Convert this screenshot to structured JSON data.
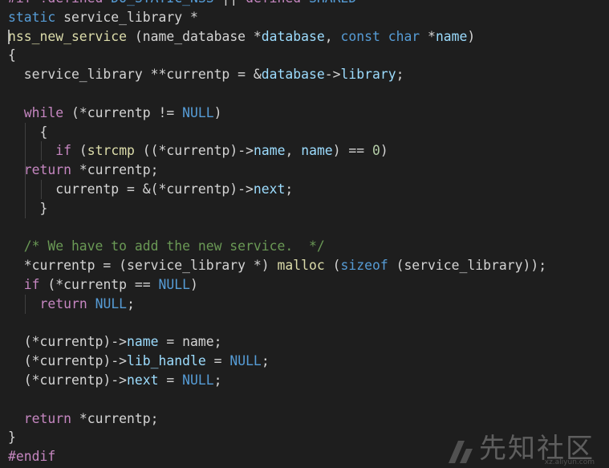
{
  "editor": {
    "colors": {
      "background": "#1e1e1e",
      "keyword": "#569cd6",
      "control": "#c586c0",
      "type": "#4ec9b0",
      "function": "#dcdcaa",
      "param": "#9cdcfe",
      "number": "#b5cea8",
      "comment": "#6a9955",
      "plain": "#d4d4d4"
    },
    "lines": [
      {
        "guides": 0,
        "caret": false,
        "tokens": [
          {
            "t": "#if !defined ",
            "c": "ctrl"
          },
          {
            "t": "DO_STATIC_NSS",
            "c": "kw"
          },
          {
            "t": " || ",
            "c": "plain"
          },
          {
            "t": "defined ",
            "c": "ctrl"
          },
          {
            "t": "SHARED",
            "c": "kw"
          }
        ]
      },
      {
        "guides": 0,
        "caret": false,
        "tokens": [
          {
            "t": "static ",
            "c": "kw"
          },
          {
            "t": "service_library *",
            "c": "plain"
          }
        ]
      },
      {
        "guides": 0,
        "caret": true,
        "tokens": [
          {
            "t": "nss_new_service",
            "c": "func"
          },
          {
            "t": " (name_database *",
            "c": "plain"
          },
          {
            "t": "database",
            "c": "param"
          },
          {
            "t": ", ",
            "c": "plain"
          },
          {
            "t": "const char",
            "c": "kw"
          },
          {
            "t": " *",
            "c": "plain"
          },
          {
            "t": "name",
            "c": "param"
          },
          {
            "t": ")",
            "c": "plain"
          }
        ]
      },
      {
        "guides": 0,
        "caret": false,
        "tokens": [
          {
            "t": "{",
            "c": "plain"
          }
        ]
      },
      {
        "guides": 0,
        "caret": false,
        "tokens": [
          {
            "t": "  service_library **currentp = &",
            "c": "plain"
          },
          {
            "t": "database",
            "c": "param"
          },
          {
            "t": "->",
            "c": "plain"
          },
          {
            "t": "library",
            "c": "param"
          },
          {
            "t": ";",
            "c": "plain"
          }
        ]
      },
      {
        "guides": 0,
        "caret": false,
        "tokens": [
          {
            "t": "",
            "c": "plain"
          }
        ]
      },
      {
        "guides": 0,
        "caret": false,
        "tokens": [
          {
            "t": "  ",
            "c": "plain"
          },
          {
            "t": "while",
            "c": "ctrl"
          },
          {
            "t": " (*currentp != ",
            "c": "plain"
          },
          {
            "t": "NULL",
            "c": "kw"
          },
          {
            "t": ")",
            "c": "plain"
          }
        ]
      },
      {
        "guides": 1,
        "caret": false,
        "tokens": [
          {
            "t": "    {",
            "c": "plain"
          }
        ]
      },
      {
        "guides": 2,
        "caret": false,
        "tokens": [
          {
            "t": "      ",
            "c": "plain"
          },
          {
            "t": "if",
            "c": "ctrl"
          },
          {
            "t": " (",
            "c": "plain"
          },
          {
            "t": "strcmp",
            "c": "func"
          },
          {
            "t": " ((*currentp)->",
            "c": "plain"
          },
          {
            "t": "name",
            "c": "param"
          },
          {
            "t": ", ",
            "c": "plain"
          },
          {
            "t": "name",
            "c": "param"
          },
          {
            "t": ") == ",
            "c": "plain"
          },
          {
            "t": "0",
            "c": "num"
          },
          {
            "t": ")",
            "c": "plain"
          }
        ]
      },
      {
        "guides": 1,
        "caret": false,
        "tokens": [
          {
            "t": "  ",
            "c": "plain"
          },
          {
            "t": "return",
            "c": "ctrl"
          },
          {
            "t": " *currentp;",
            "c": "plain"
          }
        ]
      },
      {
        "guides": 2,
        "caret": false,
        "tokens": [
          {
            "t": "      currentp = &(*currentp)->",
            "c": "plain"
          },
          {
            "t": "next",
            "c": "param"
          },
          {
            "t": ";",
            "c": "plain"
          }
        ]
      },
      {
        "guides": 1,
        "caret": false,
        "tokens": [
          {
            "t": "    }",
            "c": "plain"
          }
        ]
      },
      {
        "guides": 0,
        "caret": false,
        "tokens": [
          {
            "t": "",
            "c": "plain"
          }
        ]
      },
      {
        "guides": 0,
        "caret": false,
        "tokens": [
          {
            "t": "  /* We have to add the new service.  */",
            "c": "cmt"
          }
        ]
      },
      {
        "guides": 0,
        "caret": false,
        "tokens": [
          {
            "t": "  *currentp = (service_library *) ",
            "c": "plain"
          },
          {
            "t": "malloc",
            "c": "func"
          },
          {
            "t": " (",
            "c": "plain"
          },
          {
            "t": "sizeof",
            "c": "kw"
          },
          {
            "t": " (service_library));",
            "c": "plain"
          }
        ]
      },
      {
        "guides": 0,
        "caret": false,
        "tokens": [
          {
            "t": "  ",
            "c": "plain"
          },
          {
            "t": "if",
            "c": "ctrl"
          },
          {
            "t": " (*currentp == ",
            "c": "plain"
          },
          {
            "t": "NULL",
            "c": "kw"
          },
          {
            "t": ")",
            "c": "plain"
          }
        ]
      },
      {
        "guides": 1,
        "caret": false,
        "tokens": [
          {
            "t": "    ",
            "c": "plain"
          },
          {
            "t": "return",
            "c": "ctrl"
          },
          {
            "t": " ",
            "c": "plain"
          },
          {
            "t": "NULL",
            "c": "kw"
          },
          {
            "t": ";",
            "c": "plain"
          }
        ]
      },
      {
        "guides": 0,
        "caret": false,
        "tokens": [
          {
            "t": "",
            "c": "plain"
          }
        ]
      },
      {
        "guides": 0,
        "caret": false,
        "tokens": [
          {
            "t": "  (*currentp)->",
            "c": "plain"
          },
          {
            "t": "name",
            "c": "param"
          },
          {
            "t": " = name;",
            "c": "plain"
          }
        ]
      },
      {
        "guides": 0,
        "caret": false,
        "tokens": [
          {
            "t": "  (*currentp)->",
            "c": "plain"
          },
          {
            "t": "lib_handle",
            "c": "param"
          },
          {
            "t": " = ",
            "c": "plain"
          },
          {
            "t": "NULL",
            "c": "kw"
          },
          {
            "t": ";",
            "c": "plain"
          }
        ]
      },
      {
        "guides": 0,
        "caret": false,
        "tokens": [
          {
            "t": "  (*currentp)->",
            "c": "plain"
          },
          {
            "t": "next",
            "c": "param"
          },
          {
            "t": " = ",
            "c": "plain"
          },
          {
            "t": "NULL",
            "c": "kw"
          },
          {
            "t": ";",
            "c": "plain"
          }
        ]
      },
      {
        "guides": 0,
        "caret": false,
        "tokens": [
          {
            "t": "",
            "c": "plain"
          }
        ]
      },
      {
        "guides": 0,
        "caret": false,
        "tokens": [
          {
            "t": "  ",
            "c": "plain"
          },
          {
            "t": "return",
            "c": "ctrl"
          },
          {
            "t": " *currentp;",
            "c": "plain"
          }
        ]
      },
      {
        "guides": 0,
        "caret": false,
        "tokens": [
          {
            "t": "}",
            "c": "plain"
          }
        ]
      },
      {
        "guides": 0,
        "caret": false,
        "tokens": [
          {
            "t": "#endif",
            "c": "ctrl"
          }
        ]
      }
    ]
  },
  "watermark": {
    "text": "先知社区",
    "url": "xz.aliyun.com"
  }
}
